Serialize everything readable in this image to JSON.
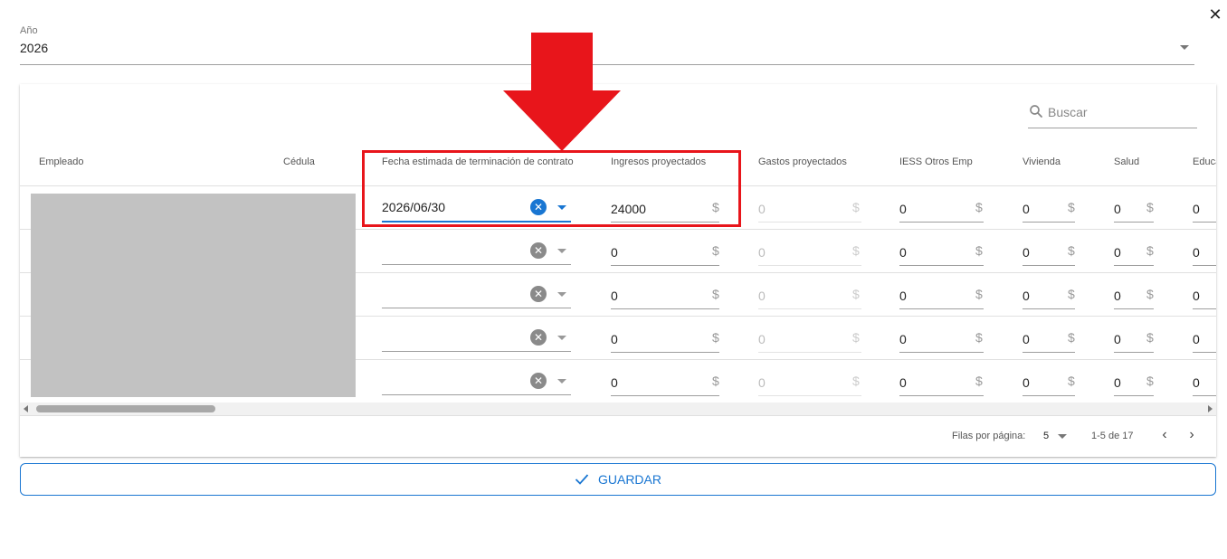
{
  "dialog": {
    "close_icon": "close-icon"
  },
  "year": {
    "label": "Año",
    "value": "2026"
  },
  "search": {
    "placeholder": "Buscar"
  },
  "columns": {
    "empleado": "Empleado",
    "cedula": "Cédula",
    "fecha": "Fecha estimada de terminación de contrato",
    "ingresos": "Ingresos proyectados",
    "gastos": "Gastos proyectados",
    "iess": "IESS Otros Emp",
    "vivienda": "Vivienda",
    "salud": "Salud",
    "educacion": "Educa"
  },
  "currency_symbol": "$",
  "rows": [
    {
      "fecha": "2026/06/30",
      "ingresos": "24000",
      "gastos": "0",
      "iess": "0",
      "vivienda": "0",
      "salud": "0",
      "educacion": "0"
    },
    {
      "fecha": "",
      "ingresos": "0",
      "gastos": "0",
      "iess": "0",
      "vivienda": "0",
      "salud": "0",
      "educacion": "0"
    },
    {
      "fecha": "",
      "ingresos": "0",
      "gastos": "0",
      "iess": "0",
      "vivienda": "0",
      "salud": "0",
      "educacion": "0"
    },
    {
      "fecha": "",
      "ingresos": "0",
      "gastos": "0",
      "iess": "0",
      "vivienda": "0",
      "salud": "0",
      "educacion": "0"
    },
    {
      "fecha": "",
      "ingresos": "0",
      "gastos": "0",
      "iess": "0",
      "vivienda": "0",
      "salud": "0",
      "educacion": "0"
    }
  ],
  "pagination": {
    "rows_per_page_label": "Filas por página:",
    "rows_per_page": "5",
    "range": "1-5 de 17"
  },
  "save_button": {
    "label": "GUARDAR"
  },
  "colors": {
    "accent": "#1976d2",
    "annotation_red": "#e8151b",
    "masked_gray": "#c2c2c2"
  }
}
